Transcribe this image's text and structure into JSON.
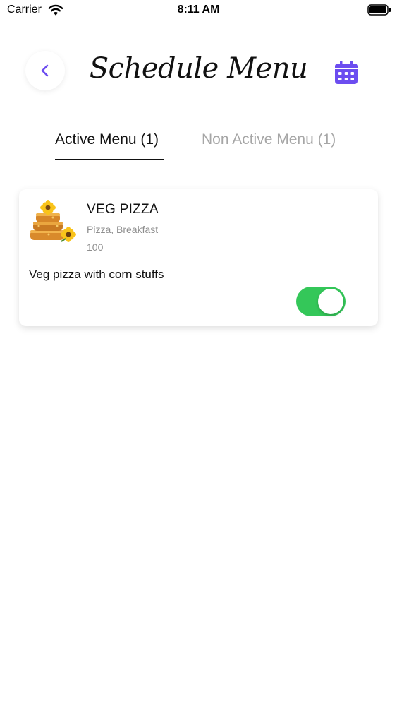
{
  "status_bar": {
    "carrier": "Carrier",
    "time": "8:11 AM",
    "wifi_icon": "wifi-icon",
    "battery_icon": "battery-full-icon"
  },
  "header": {
    "title": "Schedule Menu",
    "back_icon": "chevron-left-icon",
    "calendar_icon": "calendar-icon",
    "accent_color": "#6c4df0"
  },
  "tabs": [
    {
      "label": "Active Menu (1)",
      "selected": true
    },
    {
      "label": "Non Active Menu (1)",
      "selected": false
    }
  ],
  "menu_items": [
    {
      "name": "VEG PIZZA",
      "categories": "Pizza, Breakfast",
      "price": "100",
      "description": "Veg pizza with corn stuffs",
      "active": true,
      "toggle_color": "#34c759"
    }
  ]
}
